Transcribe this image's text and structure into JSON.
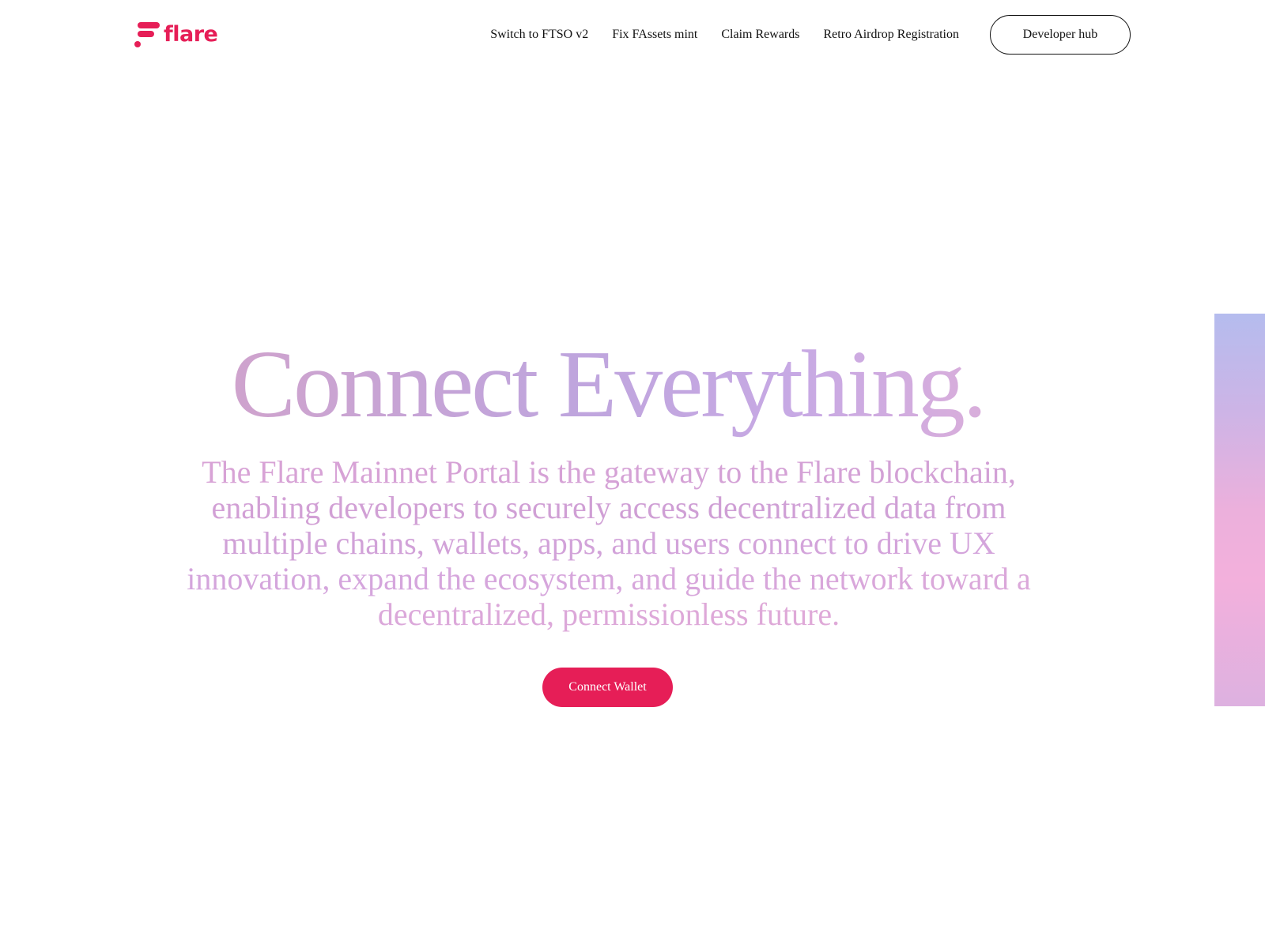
{
  "brand": {
    "name": "flare",
    "color": "#e61e57"
  },
  "nav": {
    "links": [
      {
        "label": "Switch to FTSO v2"
      },
      {
        "label": "Fix FAssets mint"
      },
      {
        "label": "Claim Rewards"
      },
      {
        "label": "Retro Airdrop Registration"
      }
    ],
    "cta_label": "Developer hub"
  },
  "hero": {
    "title": "Connect Everything.",
    "description": "The Flare Mainnet Portal is the gateway to the Flare blockchain, enabling developers to securely access decentralized data from multiple chains, wallets, apps, and users connect to drive UX innovation, expand the ecosystem, and guide the network toward a decentralized, permissionless future.",
    "button_label": "Connect Wallet"
  },
  "colors": {
    "accent": "#e61e57",
    "title_gradient": [
      "#cfa3cd",
      "#bfa5dd",
      "#d9aedb"
    ],
    "strip_gradient": [
      "#b5bcee",
      "#f3b0dc",
      "#ddb1e0"
    ]
  },
  "icons": {
    "logo": "flare-logo-icon"
  }
}
